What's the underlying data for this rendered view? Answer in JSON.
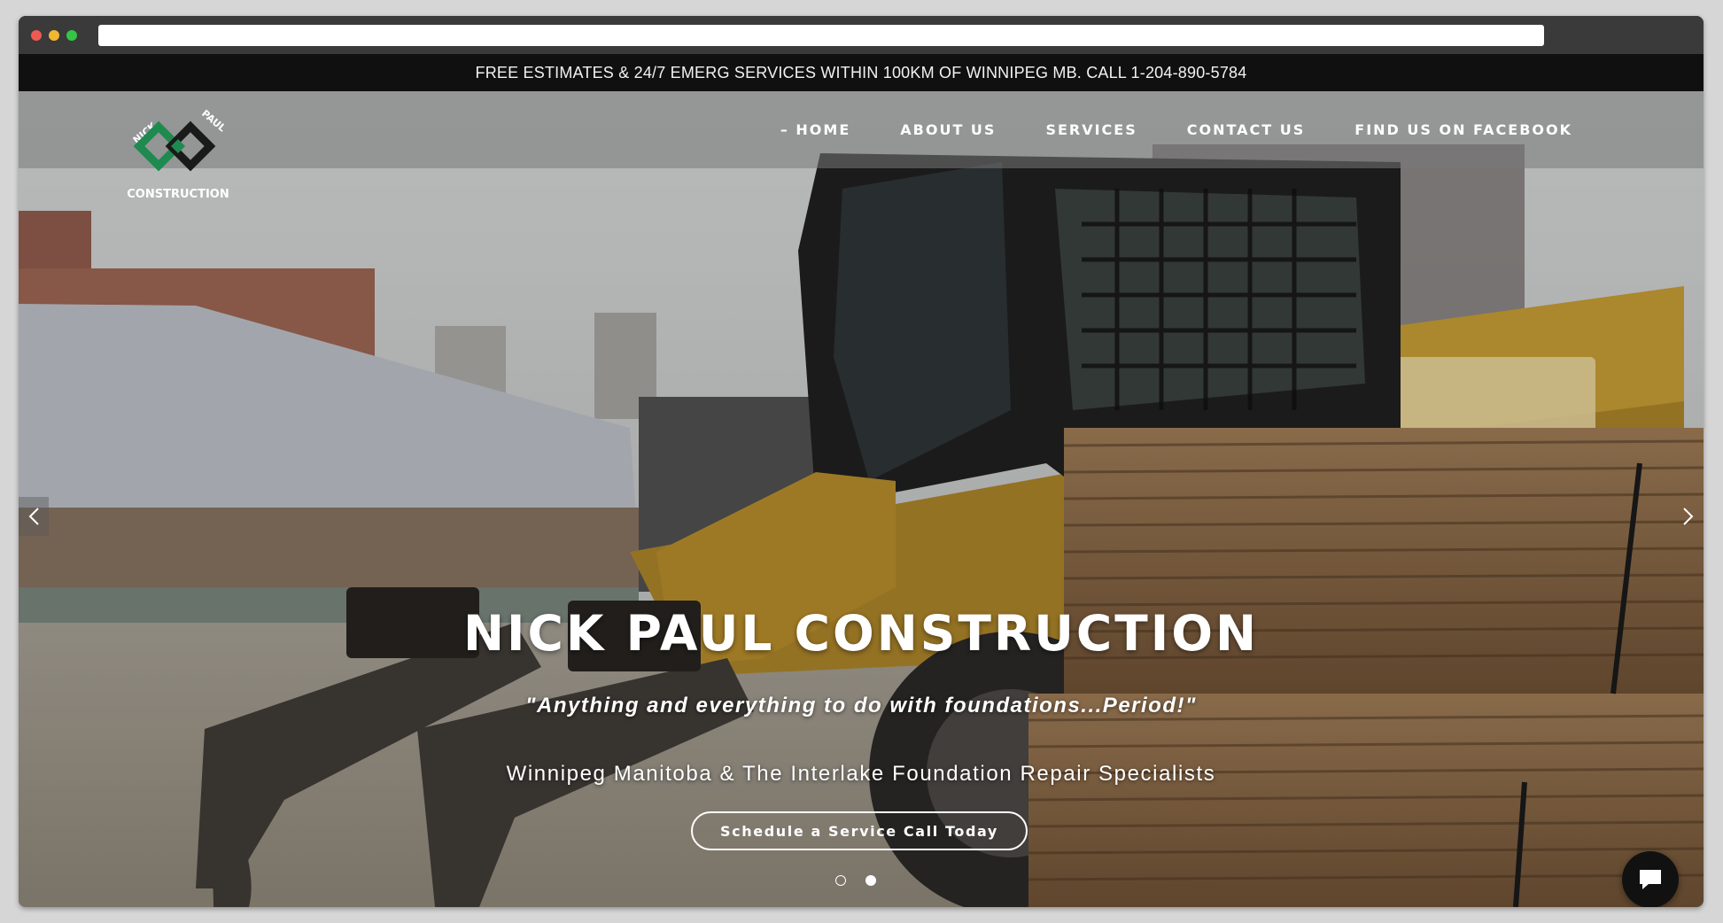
{
  "browser": {
    "url": ""
  },
  "top_bar": {
    "text": "FREE ESTIMATES & 24/7 EMERG SERVICES WITHIN 100KM OF WINNIPEG MB. CALL 1-204-890-5784"
  },
  "logo": {
    "word_left": "NICK",
    "word_right": "PAUL",
    "word_bottom": "CONSTRUCTION",
    "colors": {
      "green": "#1e8a4f",
      "dark": "#1a1a1a"
    }
  },
  "nav": {
    "items": [
      {
        "label": "– HOME"
      },
      {
        "label": "ABOUT US"
      },
      {
        "label": "SERVICES"
      },
      {
        "label": "CONTACT US"
      },
      {
        "label": "FIND US ON FACEBOOK"
      }
    ]
  },
  "hero": {
    "headline": "NICK PAUL CONSTRUCTION",
    "tagline": "\"Anything and everything to do with foundations...Period!\"",
    "subline": "Winnipeg Manitoba & The Interlake Foundation Repair Specialists",
    "cta_label": "Schedule a Service Call Today",
    "slides_total": 2,
    "active_slide": 2,
    "prev_icon": "chevron-left-icon",
    "next_icon": "chevron-right-icon"
  },
  "chat_widget": {
    "icon": "chat-bubble-icon"
  }
}
